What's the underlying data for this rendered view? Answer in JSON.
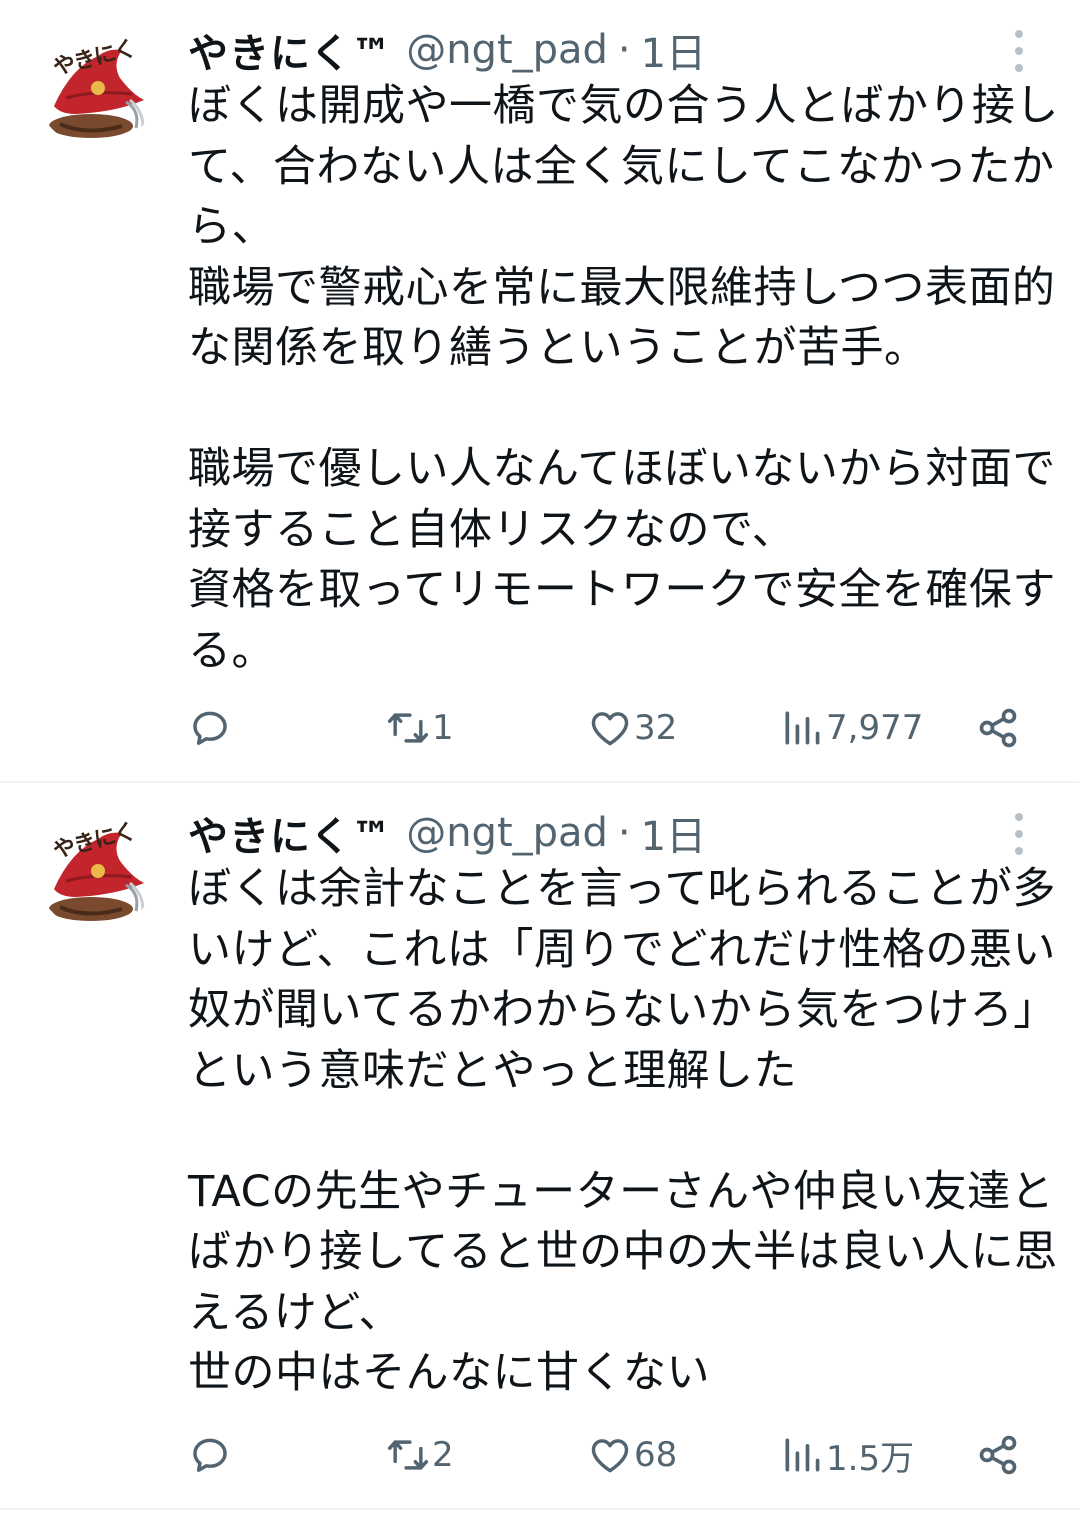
{
  "tweets": [
    {
      "avatar_text": "やきにく",
      "name": "やきにく™",
      "handle": "@ngt_pad",
      "separator": "·",
      "time": "1日",
      "text": "ぼくは開成や一橋で気の合う人とばかり接して、合わない人は全く気にしてこなかったから、\n職場で警戒心を常に最大限維持しつつ表面的な関係を取り繕うということが苦手。\n\n職場で優しい人なんてほぼいないから対面で接すること自体リスクなので、\n資格を取ってリモートワークで安全を確保する。",
      "replies": "",
      "retweets": "1",
      "likes": "32",
      "views": "7,977"
    },
    {
      "avatar_text": "やきにく",
      "name": "やきにく™",
      "handle": "@ngt_pad",
      "separator": "·",
      "time": "1日",
      "text": "ぼくは余計なことを言って叱られることが多いけど、これは「周りでどれだけ性格の悪い奴が聞いてるかわからないから気をつけろ」という意味だとやっと理解した\n\nTACの先生やチューターさんや仲良い友達とばかり接してると世の中の大半は良い人に思えるけど、\n世の中はそんなに甘くない",
      "replies": "",
      "retweets": "2",
      "likes": "68",
      "views": "1.5万"
    }
  ],
  "colors": {
    "text": "#0f1419",
    "secondary": "#536471",
    "divider": "#eff3f4",
    "avatar_hat": "#c2252b",
    "avatar_hair": "#7a4a2e"
  },
  "icons": {
    "reply": "reply-icon",
    "retweet": "retweet-icon",
    "like": "heart-icon",
    "views": "views-icon",
    "share": "share-icon",
    "more": "more-icon"
  }
}
